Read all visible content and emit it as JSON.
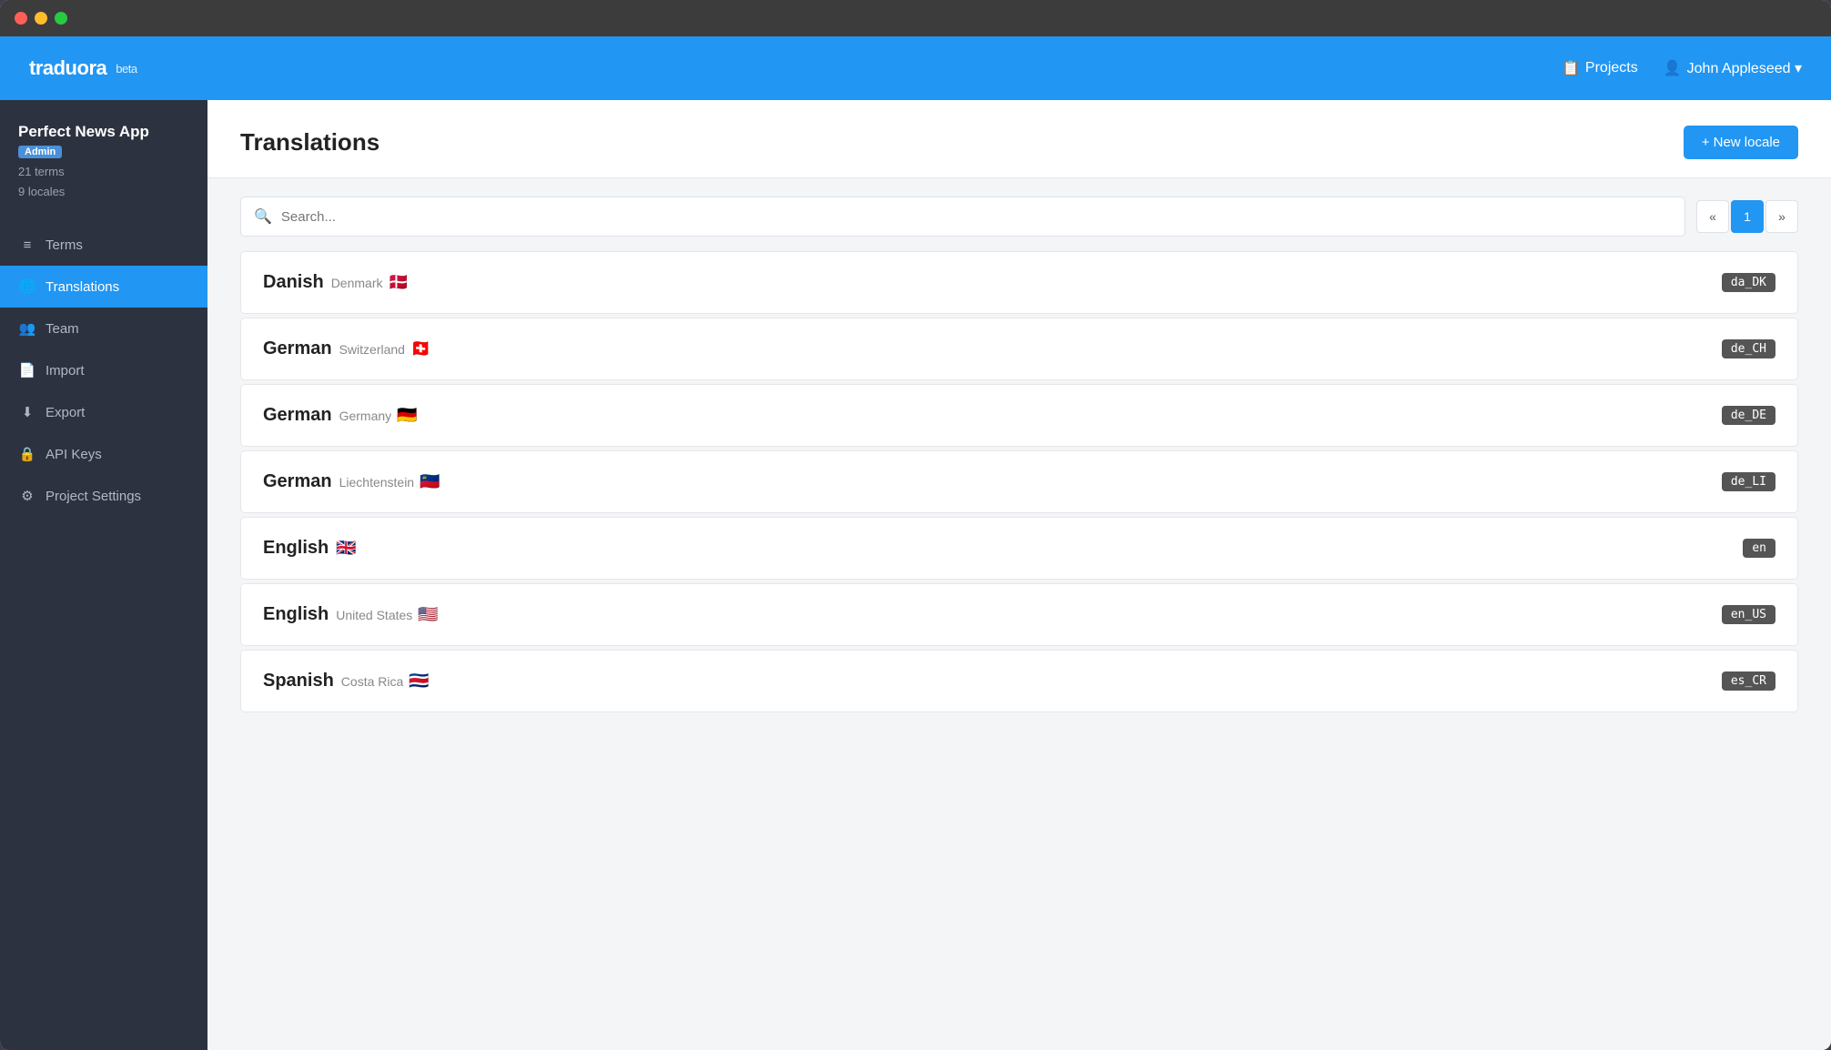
{
  "window": {
    "title": "Traduora"
  },
  "topnav": {
    "brand": "traduora",
    "beta": "beta",
    "projects_label": "Projects",
    "user_label": "John Appleseed ▾"
  },
  "sidebar": {
    "project_name": "Perfect News App",
    "badge": "Admin",
    "terms_count": "21 terms",
    "locales_count": "9 locales",
    "items": [
      {
        "id": "terms",
        "label": "Terms",
        "icon": "≡"
      },
      {
        "id": "translations",
        "label": "Translations",
        "icon": "🌐",
        "active": true
      },
      {
        "id": "team",
        "label": "Team",
        "icon": "👥"
      },
      {
        "id": "import",
        "label": "Import",
        "icon": "📄"
      },
      {
        "id": "export",
        "label": "Export",
        "icon": "⬇"
      },
      {
        "id": "api-keys",
        "label": "API Keys",
        "icon": "🔒"
      },
      {
        "id": "project-settings",
        "label": "Project Settings",
        "icon": "⚙"
      }
    ]
  },
  "content": {
    "title": "Translations",
    "new_locale_btn": "+ New locale",
    "search_placeholder": "Search...",
    "pagination": {
      "prev": "«",
      "current": "1",
      "next": "»"
    },
    "locales": [
      {
        "name": "Danish",
        "region": "Denmark",
        "flag": "🇩🇰",
        "code": "da_DK"
      },
      {
        "name": "German",
        "region": "Switzerland",
        "flag": "🇨🇭",
        "code": "de_CH"
      },
      {
        "name": "German",
        "region": "Germany",
        "flag": "🇩🇪",
        "code": "de_DE"
      },
      {
        "name": "German",
        "region": "Liechtenstein",
        "flag": "🇱🇮",
        "code": "de_LI"
      },
      {
        "name": "English",
        "region": "",
        "flag": "🇬🇧",
        "code": "en"
      },
      {
        "name": "English",
        "region": "United States",
        "flag": "🇺🇸",
        "code": "en_US"
      },
      {
        "name": "Spanish",
        "region": "Costa Rica",
        "flag": "🇨🇷",
        "code": "es_CR"
      }
    ]
  }
}
